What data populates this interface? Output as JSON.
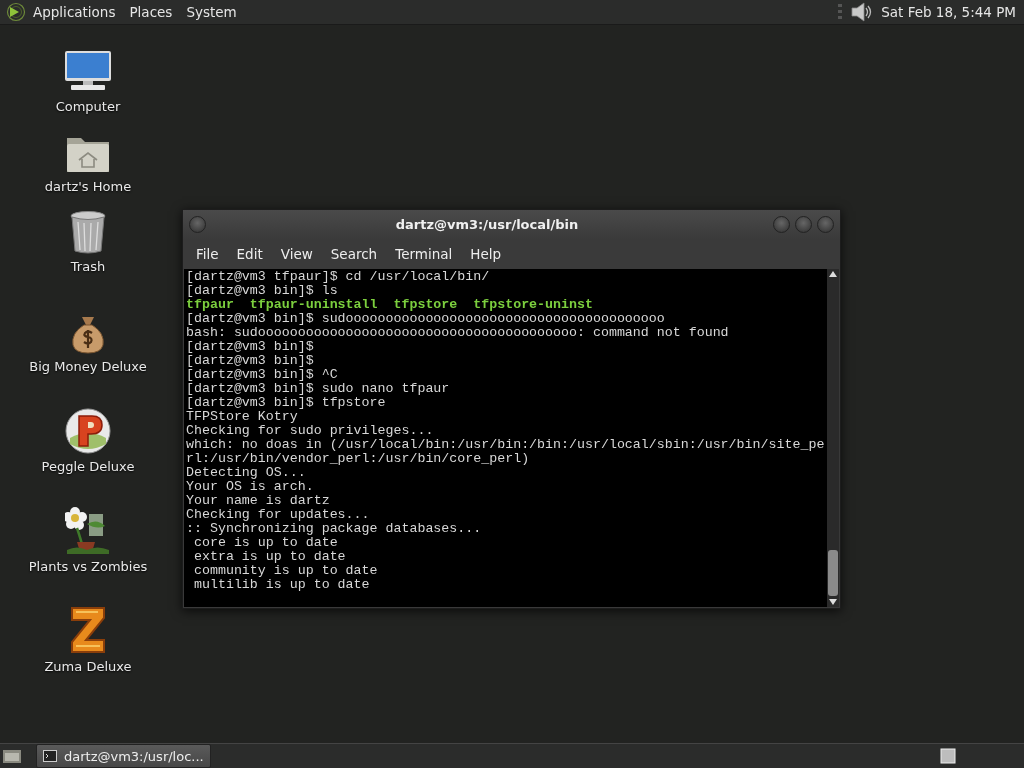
{
  "top_panel": {
    "menus": [
      "Applications",
      "Places",
      "System"
    ],
    "clock": "Sat Feb 18, 5:44 PM"
  },
  "desktop_icons": [
    {
      "label": "Computer",
      "kind": "computer"
    },
    {
      "label": "dartz's Home",
      "kind": "home"
    },
    {
      "label": "Trash",
      "kind": "trash"
    },
    {
      "label": "Big Money Deluxe",
      "kind": "money"
    },
    {
      "label": "Peggle Deluxe",
      "kind": "peggle"
    },
    {
      "label": "Plants vs Zombies",
      "kind": "plant"
    },
    {
      "label": "Zuma Deluxe",
      "kind": "zuma"
    }
  ],
  "terminal": {
    "title": "dartz@vm3:/usr/local/bin",
    "menu": [
      "File",
      "Edit",
      "View",
      "Search",
      "Terminal",
      "Help"
    ],
    "lines": [
      {
        "kind": "text",
        "text": "[dartz@vm3 tfpaur]$ cd /usr/local/bin/"
      },
      {
        "kind": "text",
        "text": "[dartz@vm3 bin]$ ls"
      },
      {
        "kind": "listing",
        "text": "tfpaur  tfpaur-uninstall  tfpstore  tfpstore-uninst"
      },
      {
        "kind": "text",
        "text": "[dartz@vm3 bin]$ sudoooooooooooooooooooooooooooooooooooooooo"
      },
      {
        "kind": "text",
        "text": "bash: sudoooooooooooooooooooooooooooooooooooooooo: command not found"
      },
      {
        "kind": "text",
        "text": "[dartz@vm3 bin]$"
      },
      {
        "kind": "text",
        "text": "[dartz@vm3 bin]$"
      },
      {
        "kind": "text",
        "text": "[dartz@vm3 bin]$ ^C"
      },
      {
        "kind": "text",
        "text": "[dartz@vm3 bin]$ sudo nano tfpaur"
      },
      {
        "kind": "text",
        "text": "[dartz@vm3 bin]$ tfpstore"
      },
      {
        "kind": "text",
        "text": "TFPStore Kotry"
      },
      {
        "kind": "text",
        "text": "Checking for sudo privileges..."
      },
      {
        "kind": "text",
        "text": "which: no doas in (/usr/local/bin:/usr/bin:/bin:/usr/local/sbin:/usr/bin/site_pe"
      },
      {
        "kind": "text",
        "text": "rl:/usr/bin/vendor_perl:/usr/bin/core_perl)"
      },
      {
        "kind": "text",
        "text": "Detecting OS..."
      },
      {
        "kind": "text",
        "text": "Your OS is arch."
      },
      {
        "kind": "text",
        "text": "Your name is dartz"
      },
      {
        "kind": "text",
        "text": "Checking for updates..."
      },
      {
        "kind": "text",
        "text": ":: Synchronizing package databases..."
      },
      {
        "kind": "text",
        "text": " core is up to date"
      },
      {
        "kind": "text",
        "text": " extra is up to date"
      },
      {
        "kind": "text",
        "text": " community is up to date"
      },
      {
        "kind": "text",
        "text": " multilib is up to date"
      }
    ]
  },
  "taskbar": {
    "tasks": [
      {
        "label": "dartz@vm3:/usr/loc...",
        "selected": true
      }
    ]
  }
}
